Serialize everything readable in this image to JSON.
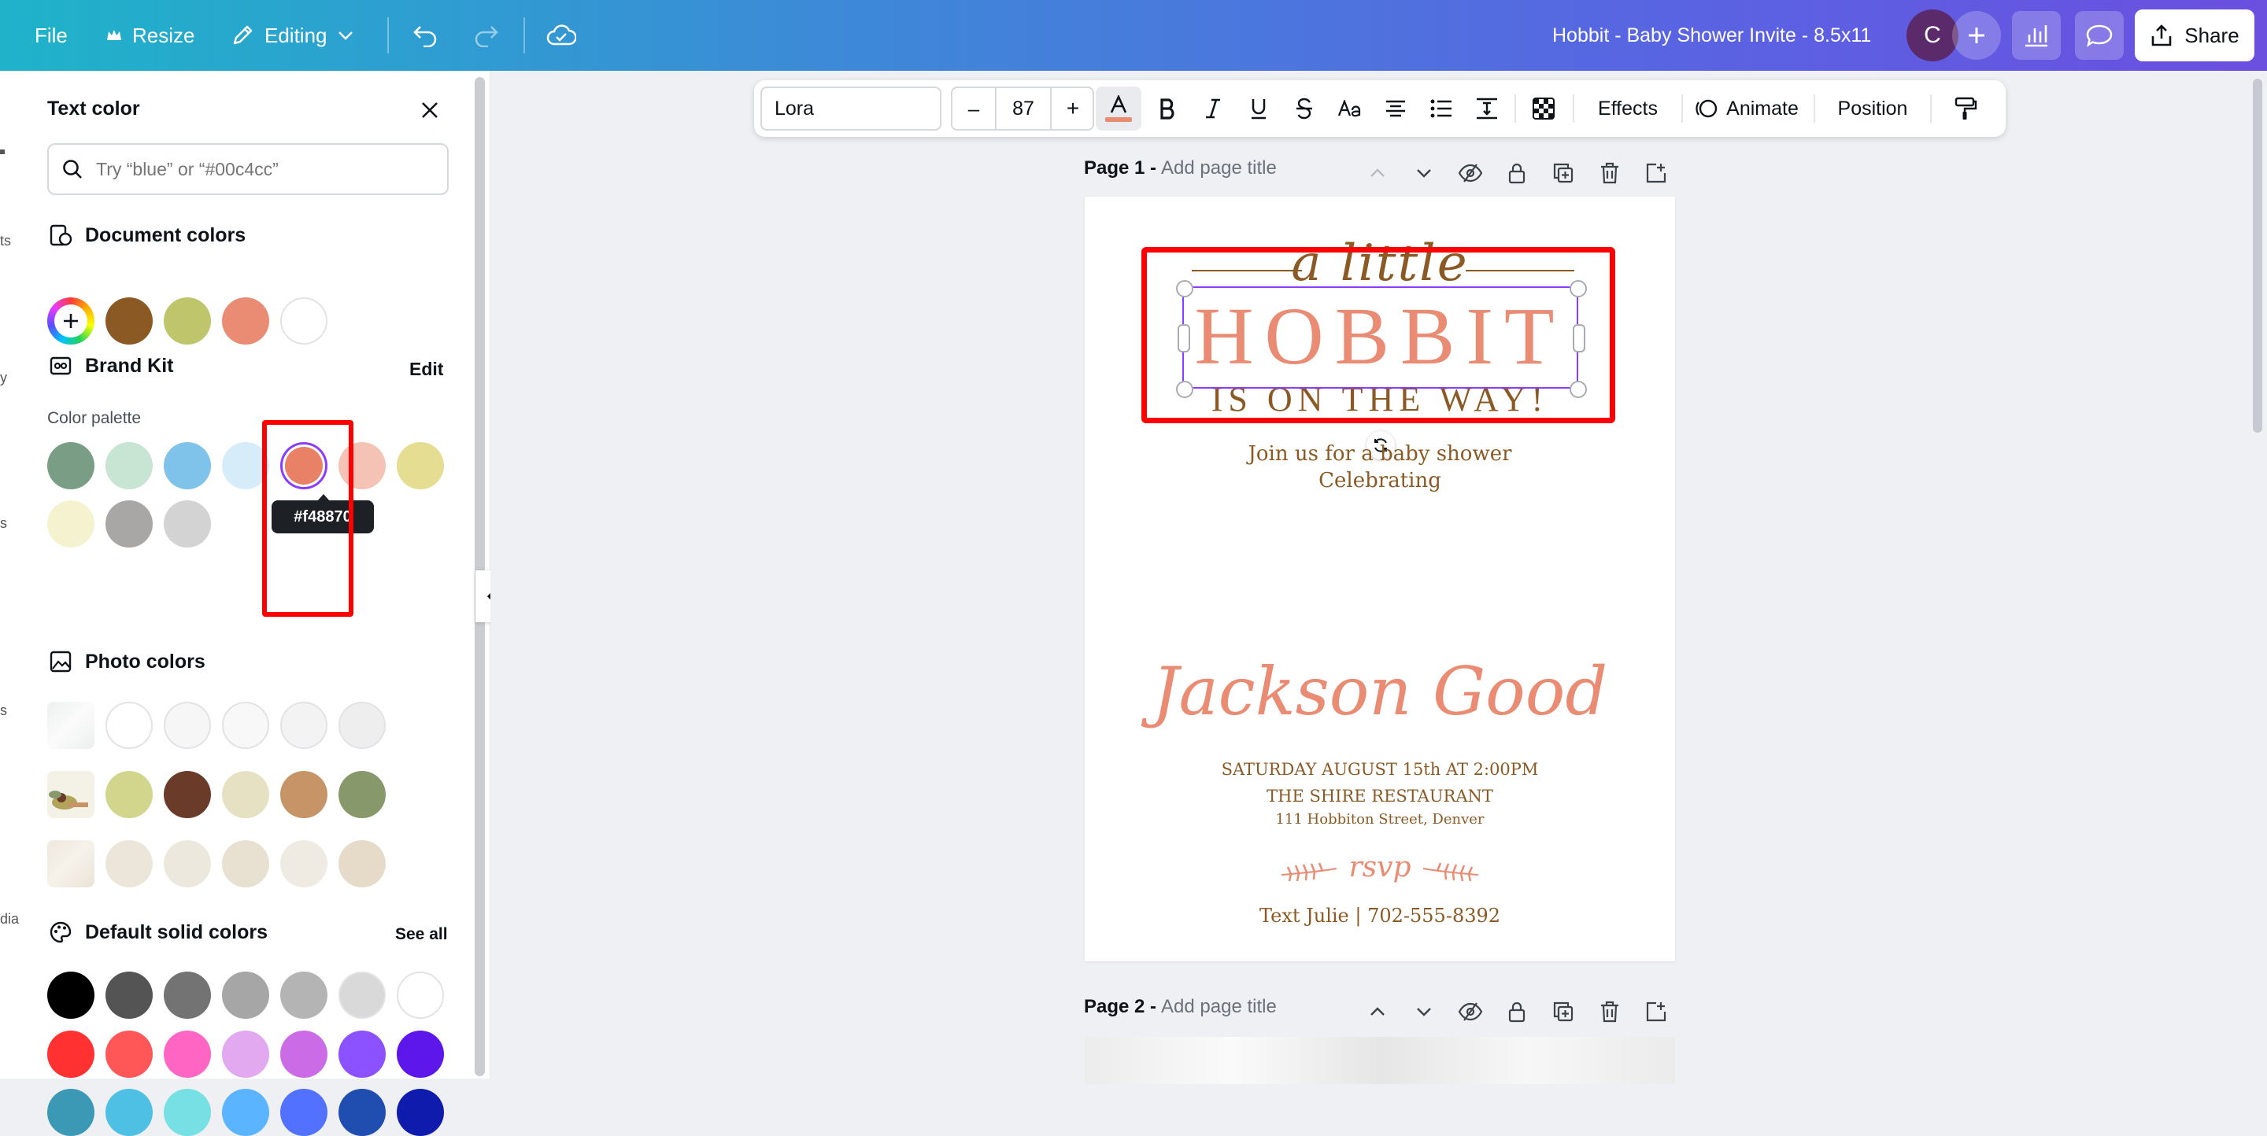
{
  "topbar": {
    "file": "File",
    "resize": "Resize",
    "editing": "Editing",
    "doc_title": "Hobbit - Baby Shower Invite - 8.5x11",
    "avatar_initial": "C",
    "share": "Share"
  },
  "rail": {
    "fragments": [
      "ts",
      "y",
      "s",
      "s",
      "dia"
    ]
  },
  "panel": {
    "title": "Text color",
    "search_placeholder": "Try “blue” or “#00c4cc”",
    "document_colors": {
      "label": "Document colors",
      "colors": [
        "#8b5a24",
        "#bfc56b",
        "#e98c73",
        "#ffffff"
      ]
    },
    "brand_kit": {
      "label": "Brand Kit",
      "edit": "Edit",
      "palette_label": "Color palette",
      "row1": [
        "#7a9e85",
        "#c8e4d3",
        "#7fc3ea",
        "#d6ecf8",
        "#e88166",
        "#f4c3b5",
        "#e5de92"
      ],
      "row2": [
        "#f5f2d0",
        "#a9a6a6",
        "#d3d3d3"
      ],
      "tooltip": "#f48870"
    },
    "photo_colors": {
      "label": "Photo colors",
      "row1": [
        "#f3f4f4",
        "#ffffff",
        "#f6f6f6",
        "#f8f8f8",
        "#f3f3f3",
        "#eeeeee"
      ],
      "row2": [
        "#d2d58c",
        "#6b3b2a",
        "#e5e1c2",
        "#c69466",
        "#87996a"
      ],
      "row3": [
        "#ece6da",
        "#ede8de",
        "#e8e1d1",
        "#f0ebe2",
        "#e5dbc8"
      ]
    },
    "default_colors": {
      "label": "Default solid colors",
      "see_all": "See all",
      "row1": [
        "#000000",
        "#545454",
        "#737373",
        "#a6a6a6",
        "#b4b4b4",
        "#d9d9d9",
        "#ffffff"
      ],
      "row2": [
        "#ff3131",
        "#ff5757",
        "#ff66c4",
        "#e2a9f1",
        "#cb6ce6",
        "#8c52ff",
        "#5e17eb"
      ],
      "row3": [
        "#3b99b5",
        "#4ec0e4",
        "#76e0e4",
        "#5ab4ff",
        "#5271ff",
        "#1f4db0",
        "#0f1bad"
      ]
    }
  },
  "toolbar": {
    "font": "Lora",
    "font_size": "87",
    "minus": "–",
    "plus": "+",
    "effects": "Effects",
    "animate": "Animate",
    "position": "Position",
    "text_color_bar": "#e98c73"
  },
  "page1": {
    "label": "Page 1 -",
    "title_placeholder": "Add page title"
  },
  "page2": {
    "label": "Page 2 -",
    "title_placeholder": "Add page title"
  },
  "invite": {
    "a_little": "a little",
    "hobbit": "HOBBIT",
    "on_the_way": "IS ON THE WAY!",
    "join": "Join us for a baby shower",
    "celebrating": "Celebrating",
    "name": "Jackson Good",
    "date": "SATURDAY AUGUST 15th AT 2:00PM",
    "venue": "THE SHIRE RESTAURANT",
    "address": "111 Hobbiton Street, Denver",
    "rsvp": "rsvp",
    "contact": "Text Julie | 702-555-8392"
  },
  "colors": {
    "annotation_red": "#ff0000",
    "selection_purple": "#8b3dff",
    "brown": "#8b5a24",
    "salmon": "#e98c73"
  }
}
